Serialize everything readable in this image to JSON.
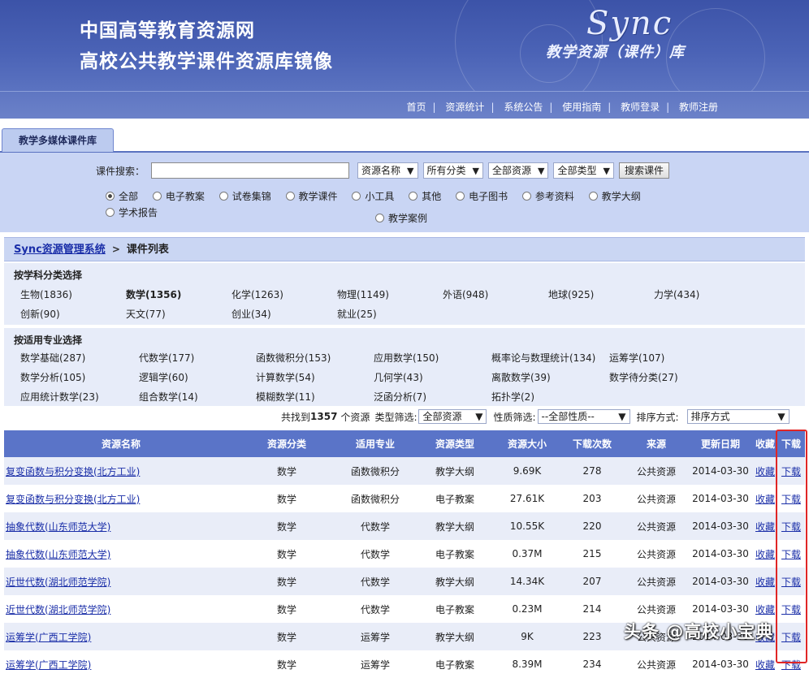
{
  "banner": {
    "title1": "中国高等教育资源网",
    "title2": "高校公共教学课件资源库镜像",
    "logo": "Sync",
    "logo_sub": "教学资源（课件）库"
  },
  "nav": [
    "首页",
    "资源统计",
    "系统公告",
    "使用指南",
    "教师登录",
    "教师注册"
  ],
  "tab": "教学多媒体课件库",
  "search": {
    "label": "课件搜索：",
    "value": "",
    "selects": [
      "资源名称",
      "所有分类",
      "全部资源",
      "全部类型"
    ],
    "button": "搜索课件",
    "radios": [
      "全部",
      "电子教案",
      "试卷集锦",
      "教学课件",
      "小工具",
      "其他",
      "电子图书",
      "参考资料",
      "教学大纲",
      "学术报告"
    ],
    "radio_extra": "教学案例",
    "selected_radio": "全部"
  },
  "breadcrumb": {
    "link": "Sync资源管理系统",
    "current": "课件列表"
  },
  "subjects": {
    "heading": "按学科分类选择",
    "rows": [
      [
        "生物(1836)",
        "数学(1356)",
        "化学(1263)",
        "物理(1149)",
        "外语(948)",
        "地球(925)",
        "力学(434)"
      ],
      [
        "创新(90)",
        "天文(77)",
        "创业(34)",
        "就业(25)"
      ]
    ],
    "selected": "数学(1356)"
  },
  "majors": {
    "heading": "按适用专业选择",
    "rows": [
      [
        "数学基础(287)",
        "代数学(177)",
        "函数微积分(153)",
        "应用数学(150)",
        "概率论与数理统计(134)",
        "运筹学(107)"
      ],
      [
        "数学分析(105)",
        "逻辑学(60)",
        "计算数学(54)",
        "几何学(43)",
        "离散数学(39)",
        "数学待分类(27)"
      ],
      [
        "应用统计数学(23)",
        "组合数学(14)",
        "模糊数学(11)",
        "泛函分析(7)",
        "拓扑学(2)"
      ]
    ]
  },
  "filter": {
    "found_prefix": "共找到",
    "count": "1357",
    "found_suffix": "个资源",
    "type_label": "类型筛选:",
    "type_value": "全部资源",
    "nature_label": "性质筛选:",
    "nature_value": "--全部性质--",
    "sort_label": "排序方式:",
    "sort_value": "排序方式"
  },
  "table": {
    "headers": [
      "资源名称",
      "资源分类",
      "适用专业",
      "资源类型",
      "资源大小",
      "下载次数",
      "来源",
      "更新日期",
      "收藏",
      "下载"
    ],
    "rows": [
      [
        "复变函数与积分变换(北方工业)",
        "数学",
        "函数微积分",
        "教学大纲",
        "9.69K",
        "278",
        "公共资源",
        "2014-03-30",
        "收藏",
        "下载"
      ],
      [
        "复变函数与积分变换(北方工业)",
        "数学",
        "函数微积分",
        "电子教案",
        "27.61K",
        "203",
        "公共资源",
        "2014-03-30",
        "收藏",
        "下载"
      ],
      [
        "抽象代数(山东师范大学)",
        "数学",
        "代数学",
        "教学大纲",
        "10.55K",
        "220",
        "公共资源",
        "2014-03-30",
        "收藏",
        "下载"
      ],
      [
        "抽象代数(山东师范大学)",
        "数学",
        "代数学",
        "电子教案",
        "0.37M",
        "215",
        "公共资源",
        "2014-03-30",
        "收藏",
        "下载"
      ],
      [
        "近世代数(湖北师范学院)",
        "数学",
        "代数学",
        "教学大纲",
        "14.34K",
        "207",
        "公共资源",
        "2014-03-30",
        "收藏",
        "下载"
      ],
      [
        "近世代数(湖北师范学院)",
        "数学",
        "代数学",
        "电子教案",
        "0.23M",
        "214",
        "公共资源",
        "2014-03-30",
        "收藏",
        "下载"
      ],
      [
        "运筹学(广西工学院)",
        "数学",
        "运筹学",
        "教学大纲",
        "9K",
        "223",
        "公共资源",
        "2014-03-30",
        "收藏",
        "下载"
      ],
      [
        "运筹学(广西工学院)",
        "数学",
        "运筹学",
        "电子教案",
        "8.39M",
        "234",
        "公共资源",
        "2014-03-30",
        "收藏",
        "下载"
      ]
    ]
  },
  "watermark": "头条 @高校小宝典",
  "colors": {
    "header_blue": "#3c53a8",
    "table_header": "#5a74c8",
    "highlight_red": "#e02626",
    "link": "#1a2ea8"
  }
}
